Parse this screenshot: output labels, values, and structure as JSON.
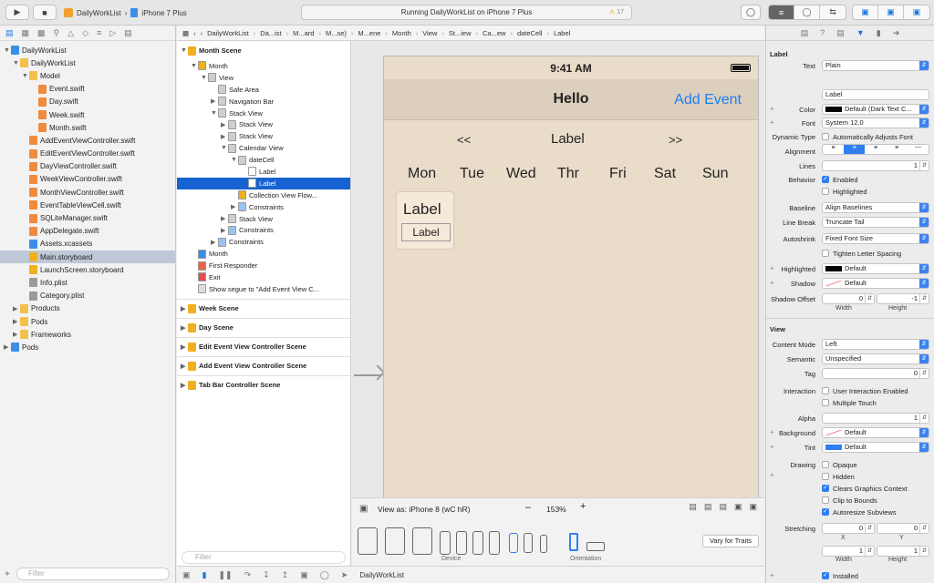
{
  "toolbar": {
    "scheme": "DailyWorkList",
    "device": "iPhone 7 Plus",
    "activity": "Running DailyWorkList on iPhone 7 Plus",
    "warnings": "17"
  },
  "navigator": {
    "items": [
      {
        "label": "DailyWorkList",
        "indent": 0,
        "icon": "project",
        "disclosure": "open"
      },
      {
        "label": "DailyWorkList",
        "indent": 1,
        "icon": "folder",
        "disclosure": "open"
      },
      {
        "label": "Model",
        "indent": 2,
        "icon": "folder",
        "disclosure": "open"
      },
      {
        "label": "Event.swift",
        "indent": 3,
        "icon": "swift"
      },
      {
        "label": "Day.swift",
        "indent": 3,
        "icon": "swift"
      },
      {
        "label": "Week.swift",
        "indent": 3,
        "icon": "swift"
      },
      {
        "label": "Month.swift",
        "indent": 3,
        "icon": "swift"
      },
      {
        "label": "AddEventViewController.swift",
        "indent": 2,
        "icon": "swift"
      },
      {
        "label": "EditEventViewController.swift",
        "indent": 2,
        "icon": "swift"
      },
      {
        "label": "DayViewController.swift",
        "indent": 2,
        "icon": "swift"
      },
      {
        "label": "WeekViewController.swift",
        "indent": 2,
        "icon": "swift"
      },
      {
        "label": "MonthViewController.swift",
        "indent": 2,
        "icon": "swift"
      },
      {
        "label": "EventTableViewCell.swift",
        "indent": 2,
        "icon": "swift"
      },
      {
        "label": "SQLiteManager.swift",
        "indent": 2,
        "icon": "swift"
      },
      {
        "label": "AppDelegate.swift",
        "indent": 2,
        "icon": "swift"
      },
      {
        "label": "Assets.xcassets",
        "indent": 2,
        "icon": "assets"
      },
      {
        "label": "Main.storyboard",
        "indent": 2,
        "icon": "storyboard",
        "selected": true
      },
      {
        "label": "LaunchScreen.storyboard",
        "indent": 2,
        "icon": "storyboard"
      },
      {
        "label": "Info.plist",
        "indent": 2,
        "icon": "plist"
      },
      {
        "label": "Category.plist",
        "indent": 2,
        "icon": "plist"
      },
      {
        "label": "Products",
        "indent": 1,
        "icon": "folder",
        "disclosure": "closed"
      },
      {
        "label": "Pods",
        "indent": 1,
        "icon": "folder",
        "disclosure": "closed"
      },
      {
        "label": "Frameworks",
        "indent": 1,
        "icon": "folder",
        "disclosure": "closed"
      },
      {
        "label": "Pods",
        "indent": 0,
        "icon": "project",
        "disclosure": "closed"
      }
    ],
    "filter_placeholder": "Filter"
  },
  "pathbar": [
    "DailyWorkList",
    "Da...ist",
    "M...ard",
    "M...se)",
    "M...ene",
    "Month",
    "View",
    "St...iew",
    "Ca...ew",
    "dateCell",
    "Label"
  ],
  "outline": {
    "month_scene": "Month Scene",
    "rows": [
      {
        "label": "Month",
        "indent": 1,
        "icon": "vc",
        "disclosure": "open"
      },
      {
        "label": "View",
        "indent": 2,
        "icon": "view",
        "disclosure": "open"
      },
      {
        "label": "Safe Area",
        "indent": 3,
        "icon": "view"
      },
      {
        "label": "Navigation Bar",
        "indent": 3,
        "icon": "view",
        "disclosure": "closed"
      },
      {
        "label": "Stack View",
        "indent": 3,
        "icon": "view",
        "disclosure": "open"
      },
      {
        "label": "Stack View",
        "indent": 4,
        "icon": "view",
        "disclosure": "closed"
      },
      {
        "label": "Stack View",
        "indent": 4,
        "icon": "view",
        "disclosure": "closed"
      },
      {
        "label": "Calendar View",
        "indent": 4,
        "icon": "view",
        "disclosure": "open"
      },
      {
        "label": "dateCell",
        "indent": 5,
        "icon": "view",
        "disclosure": "open"
      },
      {
        "label": "Label",
        "indent": 6,
        "icon": "label"
      },
      {
        "label": "Label",
        "indent": 6,
        "icon": "label",
        "selected": true
      },
      {
        "label": "Collection View Flow...",
        "indent": 5,
        "icon": "flow"
      },
      {
        "label": "Constraints",
        "indent": 5,
        "icon": "constraint",
        "disclosure": "closed"
      },
      {
        "label": "Stack View",
        "indent": 4,
        "icon": "view",
        "disclosure": "closed"
      },
      {
        "label": "Constraints",
        "indent": 4,
        "icon": "constraint",
        "disclosure": "closed"
      },
      {
        "label": "Constraints",
        "indent": 3,
        "icon": "constraint",
        "disclosure": "closed"
      },
      {
        "label": "Month",
        "indent": 1,
        "icon": "star"
      },
      {
        "label": "First Responder",
        "indent": 1,
        "icon": "responder"
      },
      {
        "label": "Exit",
        "indent": 1,
        "icon": "exit"
      },
      {
        "label": "Show segue to \"Add Event View C...",
        "indent": 1,
        "icon": "segue"
      }
    ],
    "scenes": [
      "Week Scene",
      "Day Scene",
      "Edit Event View Controller Scene",
      "Add Event View Controller Scene",
      "Tab Bar Controller Scene"
    ],
    "filter_placeholder": "Filter"
  },
  "canvas": {
    "time": "9:41 AM",
    "nav_title": "Hello",
    "nav_right": "Add Event",
    "prev": "<<",
    "month_label": "Label",
    "next": ">>",
    "days": [
      "Mon",
      "Tue",
      "Wed",
      "Thr",
      "Fri",
      "Sat",
      "Sun"
    ],
    "cell_label_top": "Label",
    "cell_label_bottom": "Label"
  },
  "bottombar": {
    "view_as": "View as: iPhone 8 (wC hR)",
    "zoom": "153%",
    "device_caption": "Device",
    "orientation_caption": "Orientation",
    "vary": "Vary for Traits"
  },
  "debugbar": {
    "target": "DailyWorkList"
  },
  "inspector": {
    "label_section": "Label",
    "text_label": "Text",
    "text_value": "Plain",
    "text_content": "Label",
    "color_label": "Color",
    "color_value": "Default (Dark Text C...",
    "font_label": "Font",
    "font_value": "System 12.0",
    "dyn_label": "Dynamic Type",
    "dyn_value": "Automatically Adjusts Font",
    "alignment_label": "Alignment",
    "lines_label": "Lines",
    "lines_value": "1",
    "behavior_label": "Behavior",
    "enabled": "Enabled",
    "highlighted": "Highlighted",
    "baseline_label": "Baseline",
    "baseline_value": "Align Baselines",
    "linebreak_label": "Line Break",
    "linebreak_value": "Truncate Tail",
    "autoshrink_label": "Autoshrink",
    "autoshrink_value": "Fixed Font Size",
    "tighten": "Tighten Letter Spacing",
    "hl_label": "Highlighted",
    "hl_value": "Default",
    "shadow_label": "Shadow",
    "shadow_value": "Default",
    "so_label": "Shadow Offset",
    "so_w": "0",
    "so_h": "-1",
    "width": "Width",
    "height": "Height",
    "view_section": "View",
    "cm_label": "Content Mode",
    "cm_value": "Left",
    "sem_label": "Semantic",
    "sem_value": "Unspecified",
    "tag_label": "Tag",
    "tag_value": "0",
    "inter_label": "Interaction",
    "uie": "User Interaction Enabled",
    "mt": "Multiple Touch",
    "alpha_label": "Alpha",
    "alpha_value": "1",
    "bg_label": "Background",
    "bg_value": "Default",
    "tint_label": "Tint",
    "tint_value": "Default",
    "drawing_label": "Drawing",
    "opaque": "Opaque",
    "hidden": "Hidden",
    "cgc": "Clears Graphics Context",
    "ctb": "Clip to Bounds",
    "as": "Autoresize Subviews",
    "stretch_label": "Stretching",
    "sx": "0",
    "sy": "0",
    "sw": "1",
    "sh": "1",
    "x": "X",
    "y": "Y",
    "installed": "Installed"
  },
  "colors": {
    "accent": "#1a78e0",
    "selection": "#1762d2",
    "canvas_bg": "#e9dcc9",
    "navbar_bg": "#dccfbd"
  }
}
